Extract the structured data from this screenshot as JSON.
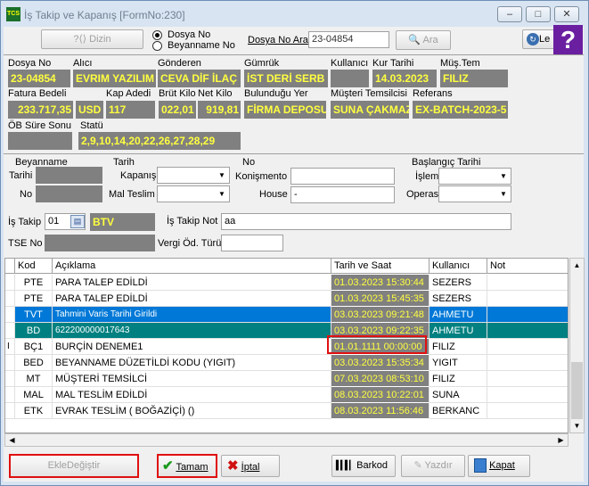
{
  "window": {
    "app_icon_text": "TCS",
    "title": "İş Takip ve Kapanış [FormNo:230]",
    "minimize": "–",
    "maximize": "□",
    "close": "✕"
  },
  "toolbar": {
    "dizin_label": "Dizin",
    "radio_dosya": "Dosya No",
    "radio_beyanname": "Beyanname No",
    "dosya_no_ara_label": "Dosya No Ara",
    "dosya_no_ara_value": "23-04854",
    "ara_label": "Ara",
    "right_button_label": "Le",
    "help": "?"
  },
  "info": {
    "dosya_no_label": "Dosya No",
    "dosya_no": "23-04854",
    "alici_label": "Alıcı",
    "alici": "EVRIM YAZILIM",
    "gonderen_label": "Gönderen",
    "gonderen": "CEVA DİF İLAÇ",
    "gumruk_label": "Gümrük",
    "gumruk": "İST DERİ SERB",
    "kullanici_label": "Kullanıcı",
    "kur_tarihi_label": "Kur Tarihi",
    "kur_tarihi": "14.03.2023",
    "mus_tem_label": "Müş.Tem",
    "mus_tem": "FILIZ",
    "fatura_bedeli_label": "Fatura Bedeli",
    "fatura_bedeli": "233.717,35",
    "currency": "USD",
    "kap_adedi_label": "Kap Adedi",
    "kap_adedi": "117",
    "brut_kilo_label": "Brüt Kilo",
    "brut_kilo": "022,01",
    "net_kilo_label": "Net Kilo",
    "net_kilo": "919,81",
    "bulundugu_yer_label": "Bulunduğu Yer",
    "bulundugu_yer": "FİRMA DEPOSU",
    "musteri_temsilcisi_label": "Müşteri Temsilcisi",
    "musteri_temsilcisi": "SUNA ÇAKMAZ",
    "referans_label": "Referans",
    "referans": "EX-BATCH-2023-5",
    "ob_sure_sonu_label": "ÖB Süre Sonu",
    "statu_label": "Statü",
    "statu": "2,9,10,14,20,22,26,27,28,29"
  },
  "filters": {
    "beyanname_label": "Beyanname",
    "tarihi_label": "Tarihi",
    "no_label": "No",
    "tarih_label": "Tarih",
    "kapanis_label": "Kapanış",
    "mal_teslim_label": "Mal Teslim",
    "no_group_label": "No",
    "konismento_label": "Konişmento",
    "house_label": "House",
    "house_value": "-",
    "baslangic_tarihi_label": "Başlangıç Tarihi",
    "islem_label": "İşlem",
    "operas_label": "Operas."
  },
  "is_takip": {
    "label": "İş Takip",
    "code": "01",
    "name": "BTV",
    "not_label": "İş Takip Not",
    "not_value": "aa",
    "tse_label": "TSE No",
    "vergi_label": "Vergi Öd. Türü"
  },
  "table": {
    "headers": [
      "Kod",
      "Açıklama",
      "Tarih ve Saat",
      "Kullanıcı",
      "Not"
    ],
    "rows": [
      {
        "marker": "",
        "kod": "PTE",
        "aciklama": "PARA TALEP EDİLDİ",
        "tarih": "01.03.2023 15:30:44",
        "kullanici": "SEZERS",
        "not": ""
      },
      {
        "marker": "",
        "kod": "PTE",
        "aciklama": "PARA TALEP EDİLDİ",
        "tarih": "01.03.2023 15:45:35",
        "kullanici": "SEZERS",
        "not": ""
      },
      {
        "marker": "",
        "kod": "TVT",
        "aciklama": "Tahmini Varis Tarihi Girildi",
        "tarih": "03.03.2023 09:21:48",
        "kullanici": "AHMETU",
        "not": ""
      },
      {
        "marker": "",
        "kod": "BD",
        "aciklama": "622200000017643",
        "tarih": "03.03.2023 09:22:35",
        "kullanici": "AHMETU",
        "not": ""
      },
      {
        "marker": "I",
        "kod": "BÇ1",
        "aciklama": "BURÇİN DENEME1",
        "tarih": "01.01.1111 00:00:00",
        "kullanici": "FILIZ",
        "not": ""
      },
      {
        "marker": "",
        "kod": "BED",
        "aciklama": "BEYANNAME DÜZETİLDİ KODU (YIGIT)",
        "tarih": "03.03.2023 15:35:34",
        "kullanici": "YIGIT",
        "not": ""
      },
      {
        "marker": "",
        "kod": "MT",
        "aciklama": "MÜŞTERİ TEMSİLCİ",
        "tarih": "07.03.2023 08:53:10",
        "kullanici": "FILIZ",
        "not": ""
      },
      {
        "marker": "",
        "kod": "MAL",
        "aciklama": "MAL TESLİM EDİLDİ",
        "tarih": "08.03.2023 10:22:01",
        "kullanici": "SUNA",
        "not": ""
      },
      {
        "marker": "",
        "kod": "ETK",
        "aciklama": "EVRAK TESLİM ( BOĞAZİÇİ) ()",
        "tarih": "08.03.2023 11:56:46",
        "kullanici": "BERKANC",
        "not": ""
      }
    ]
  },
  "buttons": {
    "ekle_degistir": "EkleDeğiştir",
    "tamam": "Tamam",
    "iptal": "İptal",
    "barkod": "Barkod",
    "yazdir": "Yazdır",
    "kapat": "Kapat"
  },
  "colors": {
    "selected_blue": "#0078d7",
    "selected_teal": "#008080",
    "date_bg": "#808080",
    "date_fg": "#ffff40",
    "highlight_red": "#e01010"
  }
}
